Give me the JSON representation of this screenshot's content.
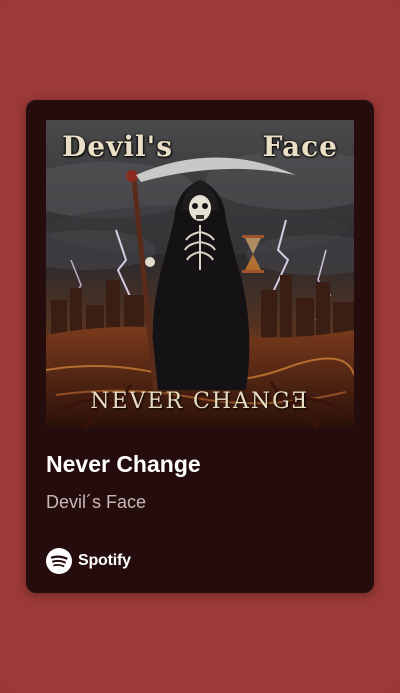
{
  "card": {
    "cover": {
      "art_title_left": "Devil's",
      "art_title_right": "Face",
      "art_subtitle": "NEVER CHANGƎ"
    },
    "title": "Never Change",
    "artist": "Devil´s Face",
    "brand": {
      "label": "Spotify",
      "icon": "spotify-logo-icon"
    }
  },
  "colors": {
    "page_background": "#9c3a37",
    "card_background": "#260d0d",
    "title_text": "#ffffff",
    "artist_text": "#c8b8b8"
  }
}
